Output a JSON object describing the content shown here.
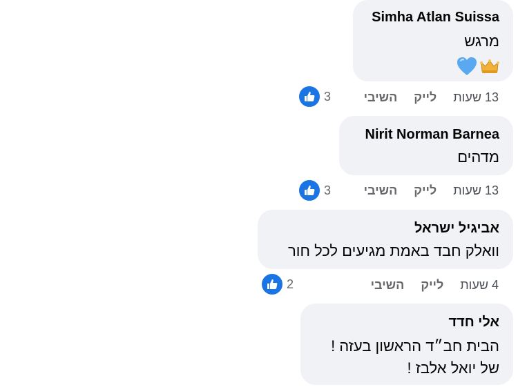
{
  "comments": [
    {
      "author": "Simha Atlan Suissa",
      "text": "מרגש",
      "emojis": [
        "crown-emoji",
        "blue-heart-emoji"
      ],
      "time": "13 שעות",
      "like_label": "לייק",
      "reply_label": "השיבי",
      "reaction_count": "3"
    },
    {
      "author": "Nirit Norman Barnea",
      "text": "מדהים",
      "time": "13 שעות",
      "like_label": "לייק",
      "reply_label": "השיבי",
      "reaction_count": "3"
    },
    {
      "author": "אביגיל ישראל",
      "text": "וואלק חבד באמת מגיעים לכל חור",
      "time": "4 שעות",
      "like_label": "לייק",
      "reply_label": "השיבי",
      "reaction_count": "2"
    },
    {
      "author": "אלי חדד",
      "text_lines": [
        "הבית חב״ד הראשון בעזה !",
        "של יואל אלבז !"
      ]
    }
  ],
  "colors": {
    "bubble": "#f0f2f5",
    "like_blue": "#1b74e4",
    "meta_gray": "#65676b",
    "heart_blue": "#5aa8f0",
    "crown_gold": "#f2b23a"
  }
}
